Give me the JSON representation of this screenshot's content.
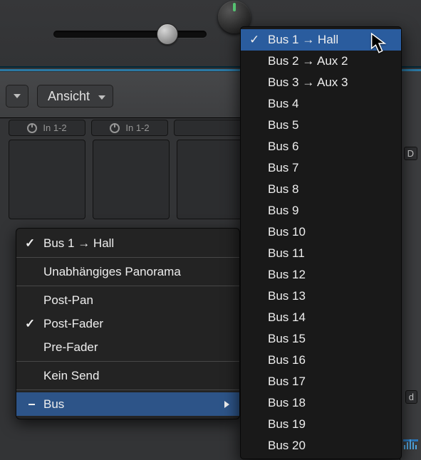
{
  "topbar": {
    "slider_value": 0.7
  },
  "toolbar": {
    "view_label": "Ansicht"
  },
  "mixer_cell_label": "In 1-2",
  "context_menu": {
    "items": [
      {
        "label": "Bus 1 → Hall",
        "checked": true
      },
      {
        "label": "Unabhängiges Panorama"
      },
      {
        "label": "Post-Pan"
      },
      {
        "label": "Post-Fader",
        "checked": true
      },
      {
        "label": "Pre-Fader"
      },
      {
        "label": "Kein Send"
      },
      {
        "label": "Bus",
        "submenu": true,
        "selected": true
      }
    ]
  },
  "bus_menu": {
    "items": [
      "Bus 1 → Hall",
      "Bus 2 → Aux 2",
      "Bus 3 → Aux 3",
      "Bus 4",
      "Bus 5",
      "Bus 6",
      "Bus 7",
      "Bus 8",
      "Bus 9",
      "Bus 10",
      "Bus 11",
      "Bus 12",
      "Bus 13",
      "Bus 14",
      "Bus 15",
      "Bus 16",
      "Bus 17",
      "Bus 18",
      "Bus 19",
      "Bus 20"
    ],
    "selected_index": 0
  },
  "right_badges": {
    "b1": "D",
    "b2": "d"
  },
  "checkmark": "✓"
}
